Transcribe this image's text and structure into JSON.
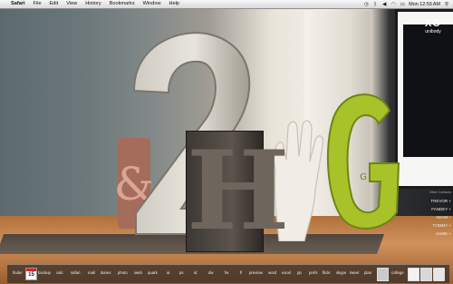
{
  "menubar": {
    "apple_glyph": "",
    "app_name": "Safari",
    "menus": [
      "File",
      "Edit",
      "View",
      "History",
      "Bookmarks",
      "Window",
      "Help"
    ],
    "clock": "Mon 12:59 AM"
  },
  "monitor": {
    "brand": "XO",
    "subtitle": "unibody"
  },
  "contacts": {
    "header": "Other Contacts",
    "names": [
      "TREVOR +",
      "FANDEY +",
      "ADAM +",
      "TOMMY +",
      "JAMIE +"
    ]
  },
  "dock": {
    "calendar_day": "15",
    "labels": [
      "finder",
      "backup",
      "calc",
      "safari",
      "mail",
      "itunes",
      "photo",
      "iweb",
      "quark",
      "ai",
      "ps",
      "id",
      "dw",
      "fw",
      "fl",
      "preview",
      "word",
      "excel",
      "pp",
      "prefs",
      "flickr",
      "skype",
      "tweet",
      "plan",
      "college"
    ]
  },
  "scene": {
    "letters": [
      "2",
      "H",
      "G",
      "&"
    ]
  }
}
